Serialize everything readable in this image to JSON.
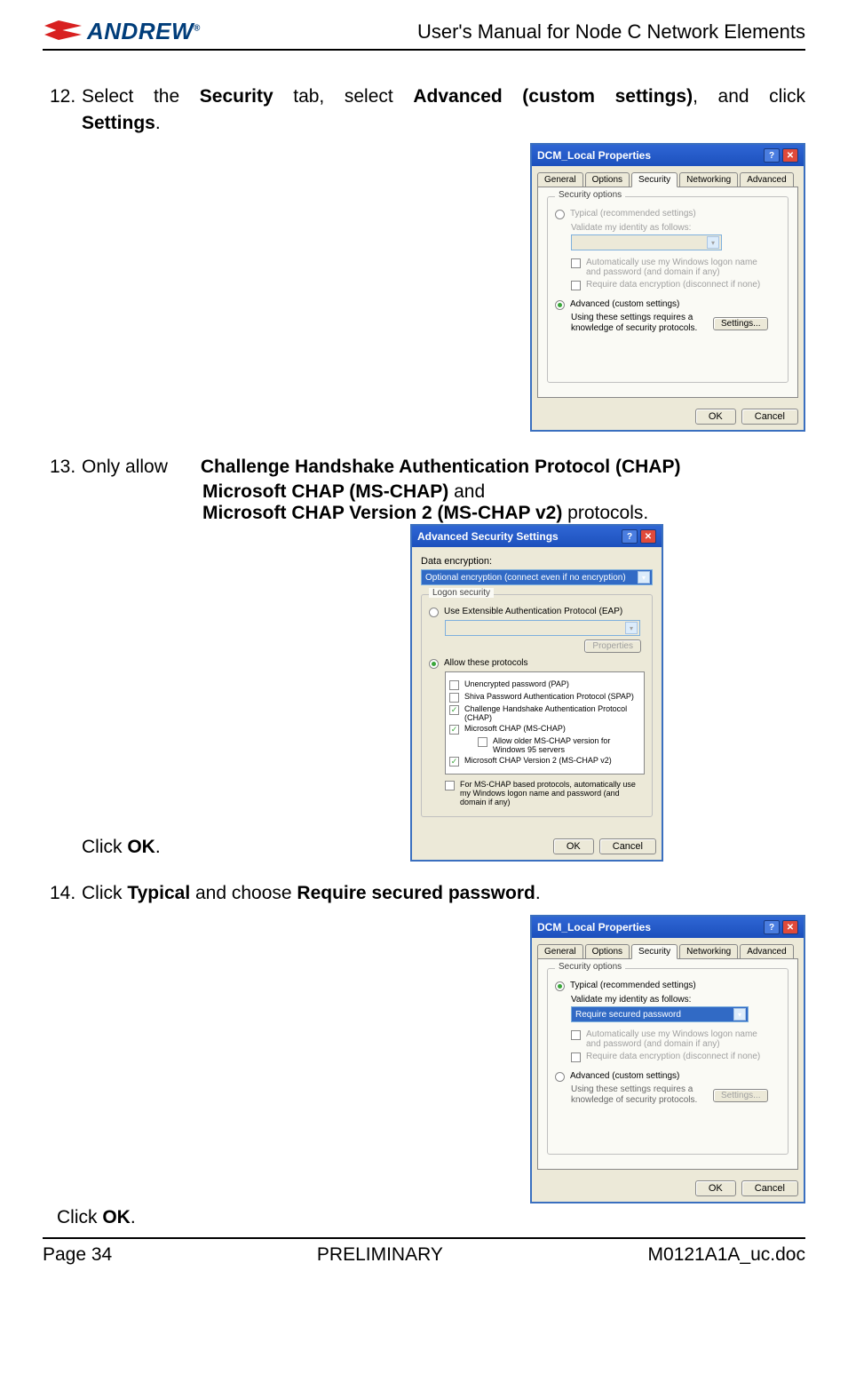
{
  "header": {
    "logo_text": "ANDREW",
    "title": "User's Manual for Node C Network Elements"
  },
  "steps": {
    "s12": {
      "num": "12.",
      "text_pre": "Select the ",
      "b1": "Security",
      "text_mid1": " tab, select ",
      "b2": "Advanced (custom settings)",
      "text_mid2": ", and click",
      "b3": "Settings",
      "text_end": "."
    },
    "s13": {
      "num": "13.",
      "lead": "Only allow",
      "line1b": "Challenge Handshake Authentication Protocol (CHAP)",
      "line2b": "Microsoft CHAP (MS-CHAP)",
      "line2t": " and",
      "line3b": "Microsoft CHAP Version 2 (MS-CHAP v2)",
      "line3t": " protocols.",
      "click_pre": "Click ",
      "click_b": "OK",
      "click_end": "."
    },
    "s14": {
      "num": "14.",
      "pre": "Click ",
      "b1": "Typical",
      "mid": " and choose ",
      "b2": "Require secured password",
      "end": ".",
      "click_pre": "Click ",
      "click_b": "OK",
      "click_end": "."
    }
  },
  "dialog1": {
    "title": "DCM_Local Properties",
    "tabs": [
      "General",
      "Options",
      "Security",
      "Networking",
      "Advanced"
    ],
    "group_label": "Security options",
    "radio_typical": "Typical (recommended settings)",
    "validate_label": "Validate my identity as follows:",
    "chk_auto": "Automatically use my Windows logon name and password (and domain if any)",
    "chk_require": "Require data encryption (disconnect if none)",
    "radio_advanced": "Advanced (custom settings)",
    "adv_note": "Using these settings requires a knowledge of security protocols.",
    "btn_settings": "Settings...",
    "btn_ok": "OK",
    "btn_cancel": "Cancel"
  },
  "dialog2": {
    "title": "Advanced Security Settings",
    "enc_label": "Data encryption:",
    "enc_value": "Optional encryption (connect even if no encryption)",
    "group_label": "Logon security",
    "radio_eap": "Use Extensible Authentication Protocol (EAP)",
    "btn_properties": "Properties",
    "radio_allow": "Allow these protocols",
    "protos": {
      "pap": "Unencrypted password (PAP)",
      "spap": "Shiva Password Authentication Protocol (SPAP)",
      "chap": "Challenge Handshake Authentication Protocol (CHAP)",
      "mschap": "Microsoft CHAP (MS-CHAP)",
      "mschap_old": "Allow older MS-CHAP version for Windows 95 servers",
      "mschapv2": "Microsoft CHAP Version 2 (MS-CHAP v2)"
    },
    "chk_winlogon": "For MS-CHAP based protocols, automatically use my Windows logon name and password (and domain if any)",
    "btn_ok": "OK",
    "btn_cancel": "Cancel"
  },
  "dialog3": {
    "title": "DCM_Local Properties",
    "tabs": [
      "General",
      "Options",
      "Security",
      "Networking",
      "Advanced"
    ],
    "group_label": "Security options",
    "radio_typical": "Typical (recommended settings)",
    "validate_label": "Validate my identity as follows:",
    "validate_value": "Require secured password",
    "chk_auto": "Automatically use my Windows logon name and password (and domain if any)",
    "chk_require": "Require data encryption (disconnect if none)",
    "radio_advanced": "Advanced (custom settings)",
    "adv_note": "Using these settings requires a knowledge of security protocols.",
    "btn_settings": "Settings...",
    "btn_ok": "OK",
    "btn_cancel": "Cancel"
  },
  "footer": {
    "page": "Page 34",
    "status": "PRELIMINARY",
    "doc": "M0121A1A_uc.doc"
  }
}
